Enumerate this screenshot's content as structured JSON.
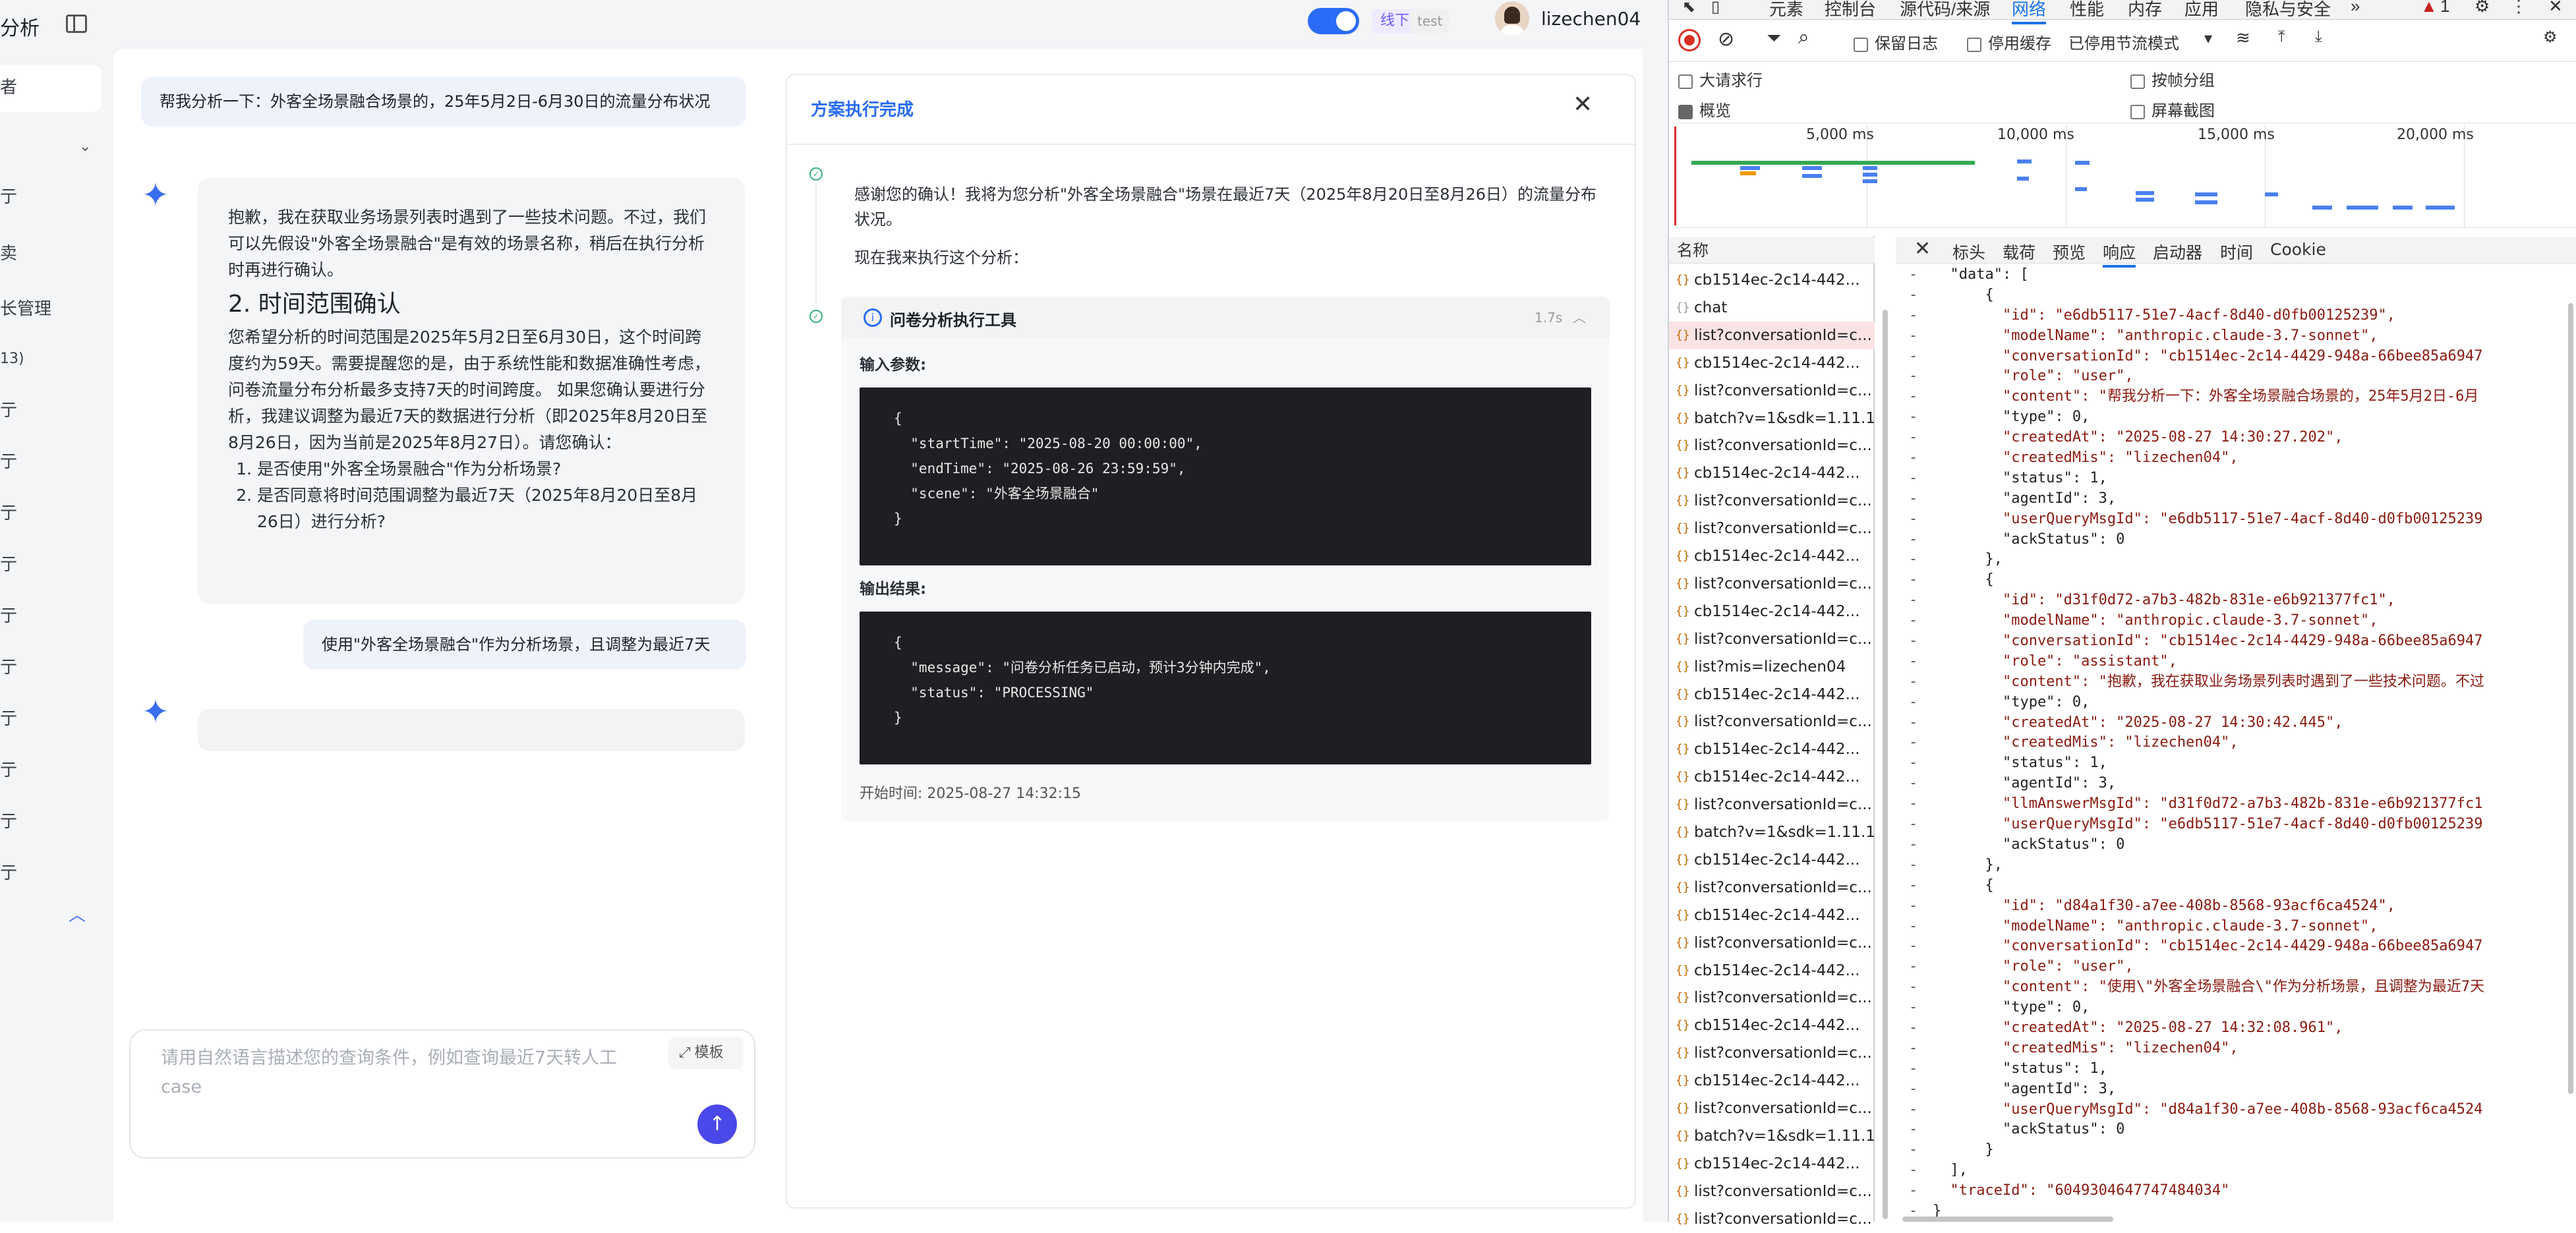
{
  "sidebar": {
    "title": "分析",
    "items": [
      "者",
      "亍",
      "卖",
      "长管理",
      "13)",
      "亍",
      "亍",
      "亍",
      "亍",
      "亍",
      "亍",
      "亍",
      "亍",
      "亍",
      "亍"
    ]
  },
  "header": {
    "env_label": "线下",
    "test_label": "test",
    "user": "lizechen04"
  },
  "chat": {
    "user_msg_1": "帮我分析一下：外客全场景融合场景的，25年5月2日-6月30日的流量分布状况",
    "bot_para_1": "抱歉，我在获取业务场景列表时遇到了一些技术问题。不过，我们可以先假设\"外客全场景融合\"是有效的场景名称，稍后在执行分析时再进行确认。",
    "bot_heading": "2. 时间范围确认",
    "bot_para_2": "您希望分析的时间范围是2025年5月2日至6月30日，这个时间跨度约为59天。需要提醒您的是，由于系统性能和数据准确性考虑，问卷流量分布分析最多支持7天的时间跨度。 如果您确认要进行分析，我建议调整为最近7天的数据进行分析（即2025年8月20日至8月26日，因为当前是2025年8月27日）。请您确认：",
    "bot_list": [
      "是否使用\"外客全场景融合\"作为分析场景?",
      "是否同意将时间范围调整为最近7天（2025年8月20日至8月26日）进行分析?"
    ],
    "user_msg_2": "使用\"外客全场景融合\"作为分析场景，且调整为最近7天"
  },
  "input": {
    "placeholder": "请用自然语言描述您的查询条件，例如查询最近7天转人工case",
    "template_label": "模板"
  },
  "panel": {
    "title": "方案执行完成",
    "text_1": "感谢您的确认！我将为您分析\"外客全场景融合\"场景在最近7天（2025年8月20日至8月26日）的流量分布状况。",
    "text_2": "现在我来执行这个分析：",
    "tool_name": "问卷分析执行工具",
    "tool_time": "1.7s",
    "input_label": "输入参数:",
    "input_code": "{\n  \"startTime\": \"2025-08-20 00:00:00\",\n  \"endTime\": \"2025-08-26 23:59:59\",\n  \"scene\": \"外客全场景融合\"\n}",
    "output_label": "输出结果:",
    "output_code": "{\n  \"message\": \"问卷分析任务已启动，预计3分钟内完成\",\n  \"status\": \"PROCESSING\"\n}",
    "start_time": "开始时间: 2025-08-27 14:32:15"
  },
  "devtools": {
    "tabs": [
      "元素",
      "控制台",
      "源代码/来源",
      "网络",
      "性能",
      "内存",
      "应用",
      "隐私与安全"
    ],
    "active_tab": "网络",
    "warning_count": "1",
    "toolbar": {
      "preserve_log": "保留日志",
      "disable_cache": "停用缓存",
      "throttle": "已停用节流模式"
    },
    "options": {
      "big_rows": "大请求行",
      "group_by_frame": "按帧分组",
      "overview": "概览",
      "screenshots": "屏幕截图"
    },
    "timeline_labels": [
      "5,000 ms",
      "10,000 ms",
      "15,000 ms",
      "20,000 ms"
    ],
    "name_header": "名称",
    "requests": [
      "cb1514ec-2c14-442...",
      "chat",
      "list?conversationId=c...",
      "cb1514ec-2c14-442...",
      "list?conversationId=c...",
      "batch?v=1&sdk=1.11.1...",
      "list?conversationId=c...",
      "cb1514ec-2c14-442...",
      "list?conversationId=c...",
      "list?conversationId=c...",
      "cb1514ec-2c14-442...",
      "list?conversationId=c...",
      "cb1514ec-2c14-442...",
      "list?conversationId=c...",
      "list?mis=lizechen04",
      "cb1514ec-2c14-442...",
      "list?conversationId=c...",
      "cb1514ec-2c14-442...",
      "cb1514ec-2c14-442...",
      "list?conversationId=c...",
      "batch?v=1&sdk=1.11.1...",
      "cb1514ec-2c14-442...",
      "list?conversationId=c...",
      "cb1514ec-2c14-442...",
      "list?conversationId=c...",
      "cb1514ec-2c14-442...",
      "list?conversationId=c...",
      "cb1514ec-2c14-442...",
      "list?conversationId=c...",
      "cb1514ec-2c14-442...",
      "list?conversationId=c...",
      "batch?v=1&sdk=1.11.1...",
      "cb1514ec-2c14-442...",
      "list?conversationId=c...",
      "list?conversationId=c..."
    ],
    "detail_tabs": [
      "标头",
      "载荷",
      "预览",
      "响应",
      "启动器",
      "时间",
      "Cookie"
    ],
    "active_detail_tab": "响应",
    "json_lines": [
      [
        "-",
        "  \"data\": ["
      ],
      [
        "-",
        "      {"
      ],
      [
        "-",
        "        \"id\": \"e6db5117-51e7-4acf-8d40-d0fb00125239\","
      ],
      [
        "-",
        "        \"modelName\": \"anthropic.claude-3.7-sonnet\","
      ],
      [
        "-",
        "        \"conversationId\": \"cb1514ec-2c14-4429-948a-66bee85a6947"
      ],
      [
        "-",
        "        \"role\": \"user\","
      ],
      [
        "-",
        "        \"content\": \"帮我分析一下：外客全场景融合场景的，25年5月2日-6月"
      ],
      [
        "-",
        "        \"type\": 0,"
      ],
      [
        "-",
        "        \"createdAt\": \"2025-08-27 14:30:27.202\","
      ],
      [
        "-",
        "        \"createdMis\": \"lizechen04\","
      ],
      [
        "-",
        "        \"status\": 1,"
      ],
      [
        "-",
        "        \"agentId\": 3,"
      ],
      [
        "-",
        "        \"userQueryMsgId\": \"e6db5117-51e7-4acf-8d40-d0fb00125239"
      ],
      [
        "-",
        "        \"ackStatus\": 0"
      ],
      [
        "-",
        "      },"
      ],
      [
        "-",
        "      {"
      ],
      [
        "-",
        "        \"id\": \"d31f0d72-a7b3-482b-831e-e6b921377fc1\","
      ],
      [
        "-",
        "        \"modelName\": \"anthropic.claude-3.7-sonnet\","
      ],
      [
        "-",
        "        \"conversationId\": \"cb1514ec-2c14-4429-948a-66bee85a6947"
      ],
      [
        "-",
        "        \"role\": \"assistant\","
      ],
      [
        "-",
        "        \"content\": \"抱歉，我在获取业务场景列表时遇到了一些技术问题。不过"
      ],
      [
        "-",
        "        \"type\": 0,"
      ],
      [
        "-",
        "        \"createdAt\": \"2025-08-27 14:30:42.445\","
      ],
      [
        "-",
        "        \"createdMis\": \"lizechen04\","
      ],
      [
        "-",
        "        \"status\": 1,"
      ],
      [
        "-",
        "        \"agentId\": 3,"
      ],
      [
        "-",
        "        \"llmAnswerMsgId\": \"d31f0d72-a7b3-482b-831e-e6b921377fc1"
      ],
      [
        "-",
        "        \"userQueryMsgId\": \"e6db5117-51e7-4acf-8d40-d0fb00125239"
      ],
      [
        "-",
        "        \"ackStatus\": 0"
      ],
      [
        "-",
        "      },"
      ],
      [
        "-",
        "      {"
      ],
      [
        "-",
        "        \"id\": \"d84a1f30-a7ee-408b-8568-93acf6ca4524\","
      ],
      [
        "-",
        "        \"modelName\": \"anthropic.claude-3.7-sonnet\","
      ],
      [
        "-",
        "        \"conversationId\": \"cb1514ec-2c14-4429-948a-66bee85a6947"
      ],
      [
        "-",
        "        \"role\": \"user\","
      ],
      [
        "-",
        "        \"content\": \"使用\\\"外客全场景融合\\\"作为分析场景，且调整为最近7天"
      ],
      [
        "-",
        "        \"type\": 0,"
      ],
      [
        "-",
        "        \"createdAt\": \"2025-08-27 14:32:08.961\","
      ],
      [
        "-",
        "        \"createdMis\": \"lizechen04\","
      ],
      [
        "-",
        "        \"status\": 1,"
      ],
      [
        "-",
        "        \"agentId\": 3,"
      ],
      [
        "-",
        "        \"userQueryMsgId\": \"d84a1f30-a7ee-408b-8568-93acf6ca4524"
      ],
      [
        "-",
        "        \"ackStatus\": 0"
      ],
      [
        "-",
        "      }"
      ],
      [
        "-",
        "  ],"
      ],
      [
        "-",
        "  \"traceId\": \"6049304647747484034\""
      ],
      [
        "-",
        "}"
      ]
    ]
  }
}
